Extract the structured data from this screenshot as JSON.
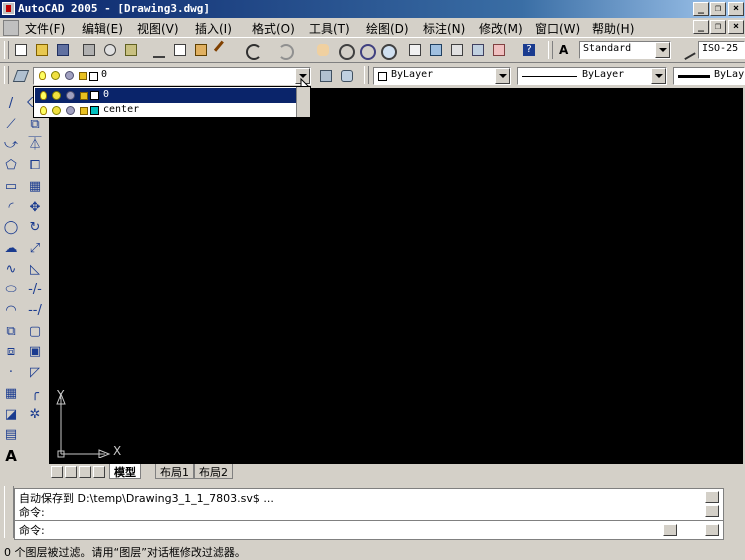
{
  "window": {
    "title": "AutoCAD 2005 - [Drawing3.dwg]"
  },
  "menubar": {
    "items": [
      "文件(F)",
      "编辑(E)",
      "视图(V)",
      "插入(I)",
      "格式(O)",
      "工具(T)",
      "绘图(D)",
      "标注(N)",
      "修改(M)",
      "窗口(W)",
      "帮助(H)"
    ]
  },
  "window_controls": {
    "min": "_",
    "restore": "❐",
    "close": "×"
  },
  "styles_toolbar": {
    "text_style": "Standard",
    "dim_style": "ISO-25"
  },
  "layers_toolbar": {
    "current_layer": "0"
  },
  "layer_list": [
    {
      "name": "0",
      "color": "#ffffff",
      "selected": true
    },
    {
      "name": "center",
      "color": "#00c0c0",
      "selected": false
    }
  ],
  "properties_toolbar": {
    "color": "ByLayer",
    "linetype": "ByLayer",
    "lineweight": "ByLay"
  },
  "ucs": {
    "y_label": "Y",
    "x_label": "X"
  },
  "tabs": [
    "模型",
    "布局1",
    "布局2"
  ],
  "command": {
    "lines": [
      "自动保存到 D:\\temp\\Drawing3_1_1_7803.sv$ ...",
      "命令:",
      "命令:"
    ]
  },
  "status": {
    "text": "0 个图层被过滤。请用“图层”对话框修改过滤器。"
  },
  "colors": {
    "canvas": "#000000",
    "chrome": "#d4d0c8",
    "title_start": "#0a246a",
    "selection": "#0a246a"
  },
  "draw_tools": [
    "line-icon",
    "xline-icon",
    "pline-icon",
    "polygon-icon",
    "rectangle-icon",
    "arc-icon",
    "circle-icon",
    "revcloud-icon",
    "spline-icon",
    "ellipse-icon",
    "ellipse-arc-icon",
    "insert-block-icon",
    "make-block-icon",
    "point-icon",
    "hatch-icon",
    "region-icon",
    "table-icon",
    "mtext-icon"
  ],
  "modify_tools": [
    "erase-icon",
    "copy-icon",
    "mirror-icon",
    "offset-icon",
    "array-icon",
    "move-icon",
    "rotate-icon",
    "scale-icon",
    "stretch-icon",
    "trim-icon",
    "extend-icon",
    "break-icon",
    "join-icon",
    "chamfer-icon",
    "fillet-icon",
    "explode-icon"
  ]
}
